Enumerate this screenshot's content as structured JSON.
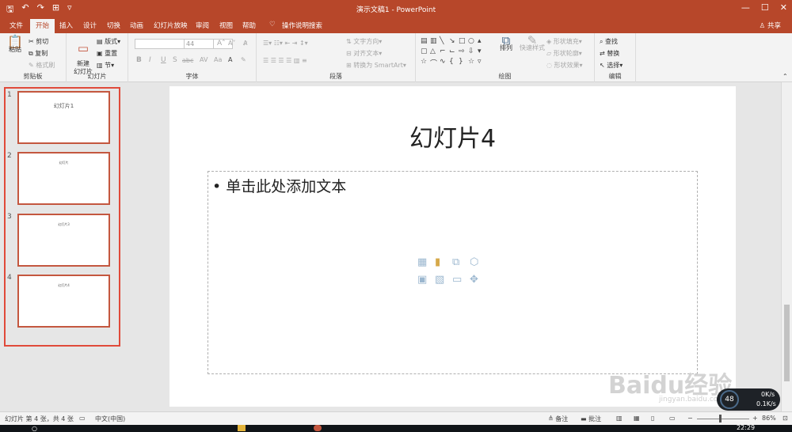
{
  "title_bar": {
    "document_title": "演示文稿1  -  PowerPoint",
    "qat_icons": [
      "save-icon",
      "undo-icon",
      "redo-icon",
      "present-icon",
      "customize-icon"
    ]
  },
  "menu": {
    "tabs": [
      "文件",
      "开始",
      "插入",
      "设计",
      "切换",
      "动画",
      "幻灯片放映",
      "审阅",
      "视图",
      "帮助"
    ],
    "active_tab": "开始",
    "tell_me": "操作说明搜索",
    "share": "共享"
  },
  "ribbon": {
    "clipboard": {
      "paste": "粘贴",
      "cut": "剪切",
      "copy": "复制",
      "format_painter": "格式刷",
      "label": "剪贴板"
    },
    "slides": {
      "new_slide": "新建\n幻灯片",
      "layout": "版式",
      "reset": "重置",
      "section": "节",
      "label": "幻灯片"
    },
    "font": {
      "font_size": "44",
      "bold": "B",
      "italic": "I",
      "underline": "U",
      "strike": "S",
      "shadow": "abc",
      "label": "字体"
    },
    "paragraph": {
      "text_direction": "文字方向",
      "align_text": "对齐文本",
      "smartart": "转换为 SmartArt",
      "label": "段落"
    },
    "drawing": {
      "arrange": "排列",
      "quick_styles": "快速样式",
      "shape_fill": "形状填充",
      "shape_outline": "形状轮廓",
      "shape_effects": "形状效果",
      "label": "绘图"
    },
    "editing": {
      "find": "查找",
      "replace": "替换",
      "select": "选择",
      "label": "编辑"
    }
  },
  "thumbnails": [
    {
      "number": "1",
      "text": "幻灯片1"
    },
    {
      "number": "2",
      "text": "幻灯片"
    },
    {
      "number": "3",
      "text": "幻灯片3"
    },
    {
      "number": "4",
      "text": "幻灯片4"
    }
  ],
  "slide": {
    "title": "幻灯片4",
    "body_placeholder": "• 单击此处添加文本"
  },
  "status": {
    "slide_info": "幻灯片 第 4 张，共 4 张",
    "language": "中文(中国)",
    "notes": "备注",
    "comments": "批注",
    "zoom": "86%"
  },
  "overlay": {
    "percent": "48",
    "up": "0K/s",
    "down": "0.1K/s"
  },
  "taskbar": {
    "time": "22:29"
  },
  "watermark": {
    "text": "Baidu经验",
    "url": "jingyan.baidu.com"
  }
}
